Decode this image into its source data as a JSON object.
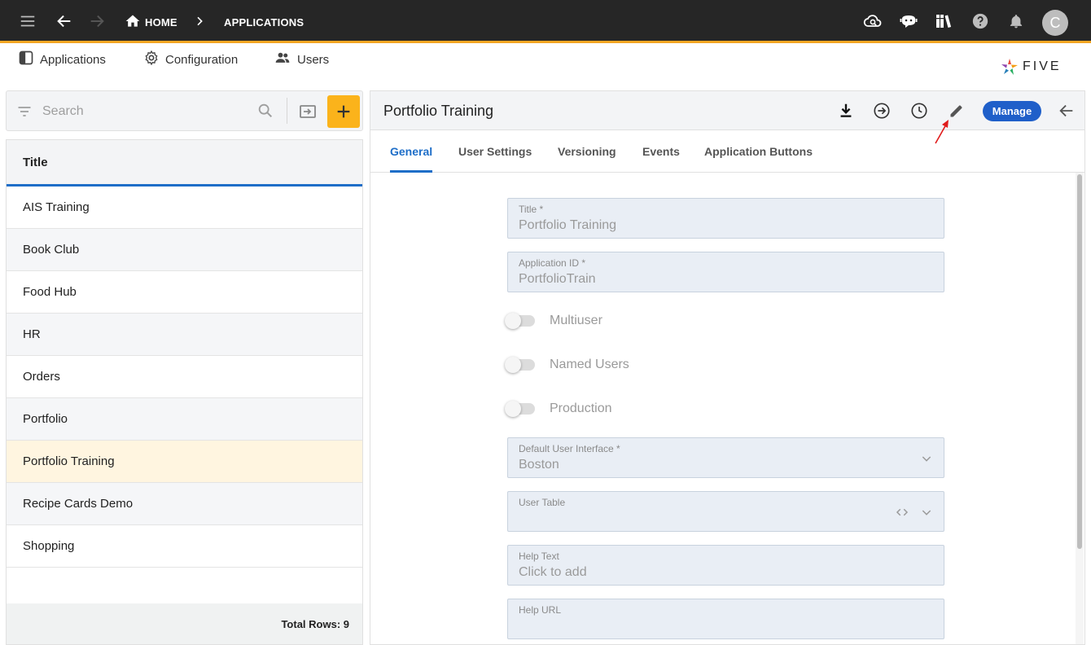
{
  "topbar": {
    "breadcrumb_home": "HOME",
    "breadcrumb_current": "APPLICATIONS",
    "avatar_initial": "C",
    "accent_color": "#f5a623"
  },
  "subnav": {
    "applications": "Applications",
    "configuration": "Configuration",
    "users": "Users",
    "logo_text": "FIVE"
  },
  "search": {
    "placeholder": "Search"
  },
  "list": {
    "header": "Title",
    "rows": [
      "AIS Training",
      "Book Club",
      "Food Hub",
      "HR",
      "Orders",
      "Portfolio",
      "Portfolio Training",
      "Recipe Cards Demo",
      "Shopping"
    ],
    "selected": "Portfolio Training",
    "footer": "Total Rows: 9"
  },
  "detail": {
    "title": "Portfolio Training",
    "manage_label": "Manage",
    "tabs": [
      "General",
      "User Settings",
      "Versioning",
      "Events",
      "Application Buttons"
    ],
    "active_tab": "General",
    "fields": {
      "title_label": "Title *",
      "title_value": "Portfolio Training",
      "appid_label": "Application ID *",
      "appid_value": "PortfolioTrain",
      "multiuser": "Multiuser",
      "named_users": "Named Users",
      "production": "Production",
      "default_ui_label": "Default User Interface *",
      "default_ui_value": "Boston",
      "user_table_label": "User Table",
      "help_text_label": "Help Text",
      "help_text_value": "Click to add",
      "help_url_label": "Help URL"
    },
    "primary_color": "#1f5fc9"
  }
}
